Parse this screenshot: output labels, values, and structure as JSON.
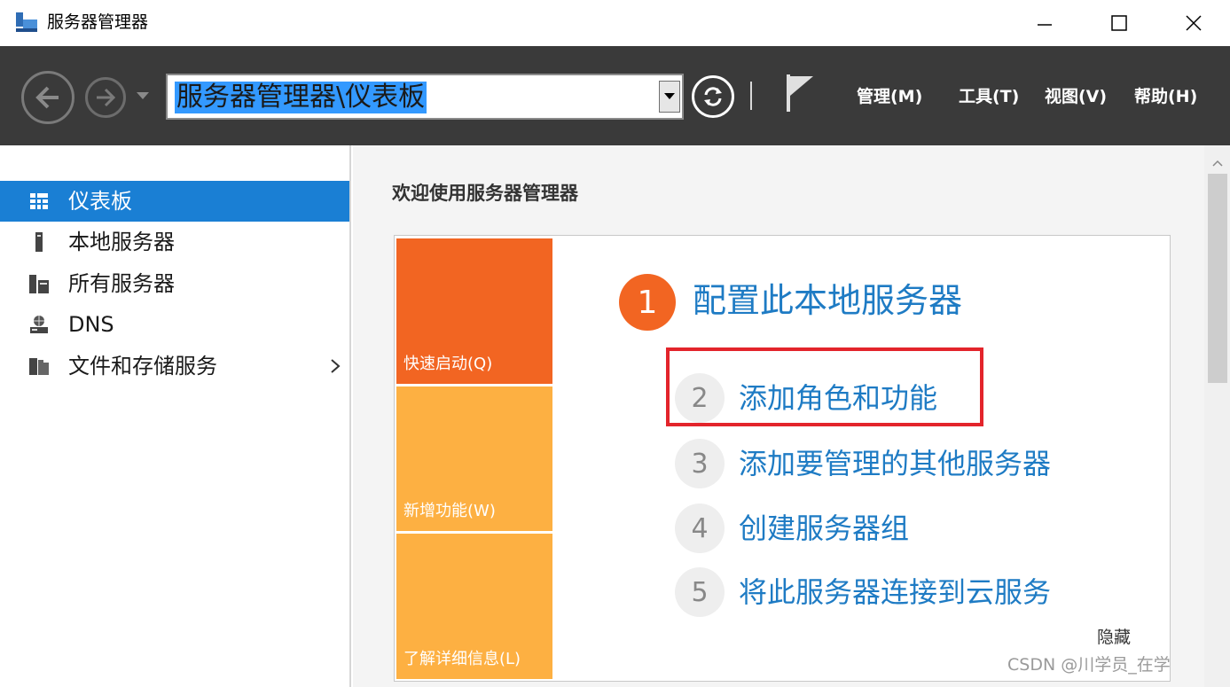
{
  "window": {
    "title": "服务器管理器"
  },
  "toolbar": {
    "address": "服务器管理器\\仪表板",
    "menus": [
      "管理(M)",
      "工具(T)",
      "视图(V)",
      "帮助(H)"
    ]
  },
  "sidebar": {
    "items": [
      {
        "label": "仪表板",
        "icon": "dashboard-icon",
        "active": true
      },
      {
        "label": "本地服务器",
        "icon": "server-icon"
      },
      {
        "label": "所有服务器",
        "icon": "servers-icon"
      },
      {
        "label": "DNS",
        "icon": "dns-icon"
      },
      {
        "label": "文件和存储服务",
        "icon": "file-storage-icon",
        "has_submenu": true
      }
    ]
  },
  "main": {
    "welcome_title": "欢迎使用服务器管理器",
    "tiles": [
      "快速启动(Q)",
      "新增功能(W)",
      "了解详细信息(L)"
    ],
    "steps": [
      {
        "num": "1",
        "label": "配置此本地服务器"
      },
      {
        "num": "2",
        "label": "添加角色和功能"
      },
      {
        "num": "3",
        "label": "添加要管理的其他服务器"
      },
      {
        "num": "4",
        "label": "创建服务器组"
      },
      {
        "num": "5",
        "label": "将此服务器连接到云服务"
      }
    ],
    "hide_label": "隐藏"
  },
  "watermark": "CSDN @川学员_在学",
  "colors": {
    "accent_blue": "#1a7fd4",
    "link_blue": "#1e7bc4",
    "tile_orange": "#f26522",
    "tile_amber": "#fdb042",
    "highlight_red": "#e3242b"
  }
}
